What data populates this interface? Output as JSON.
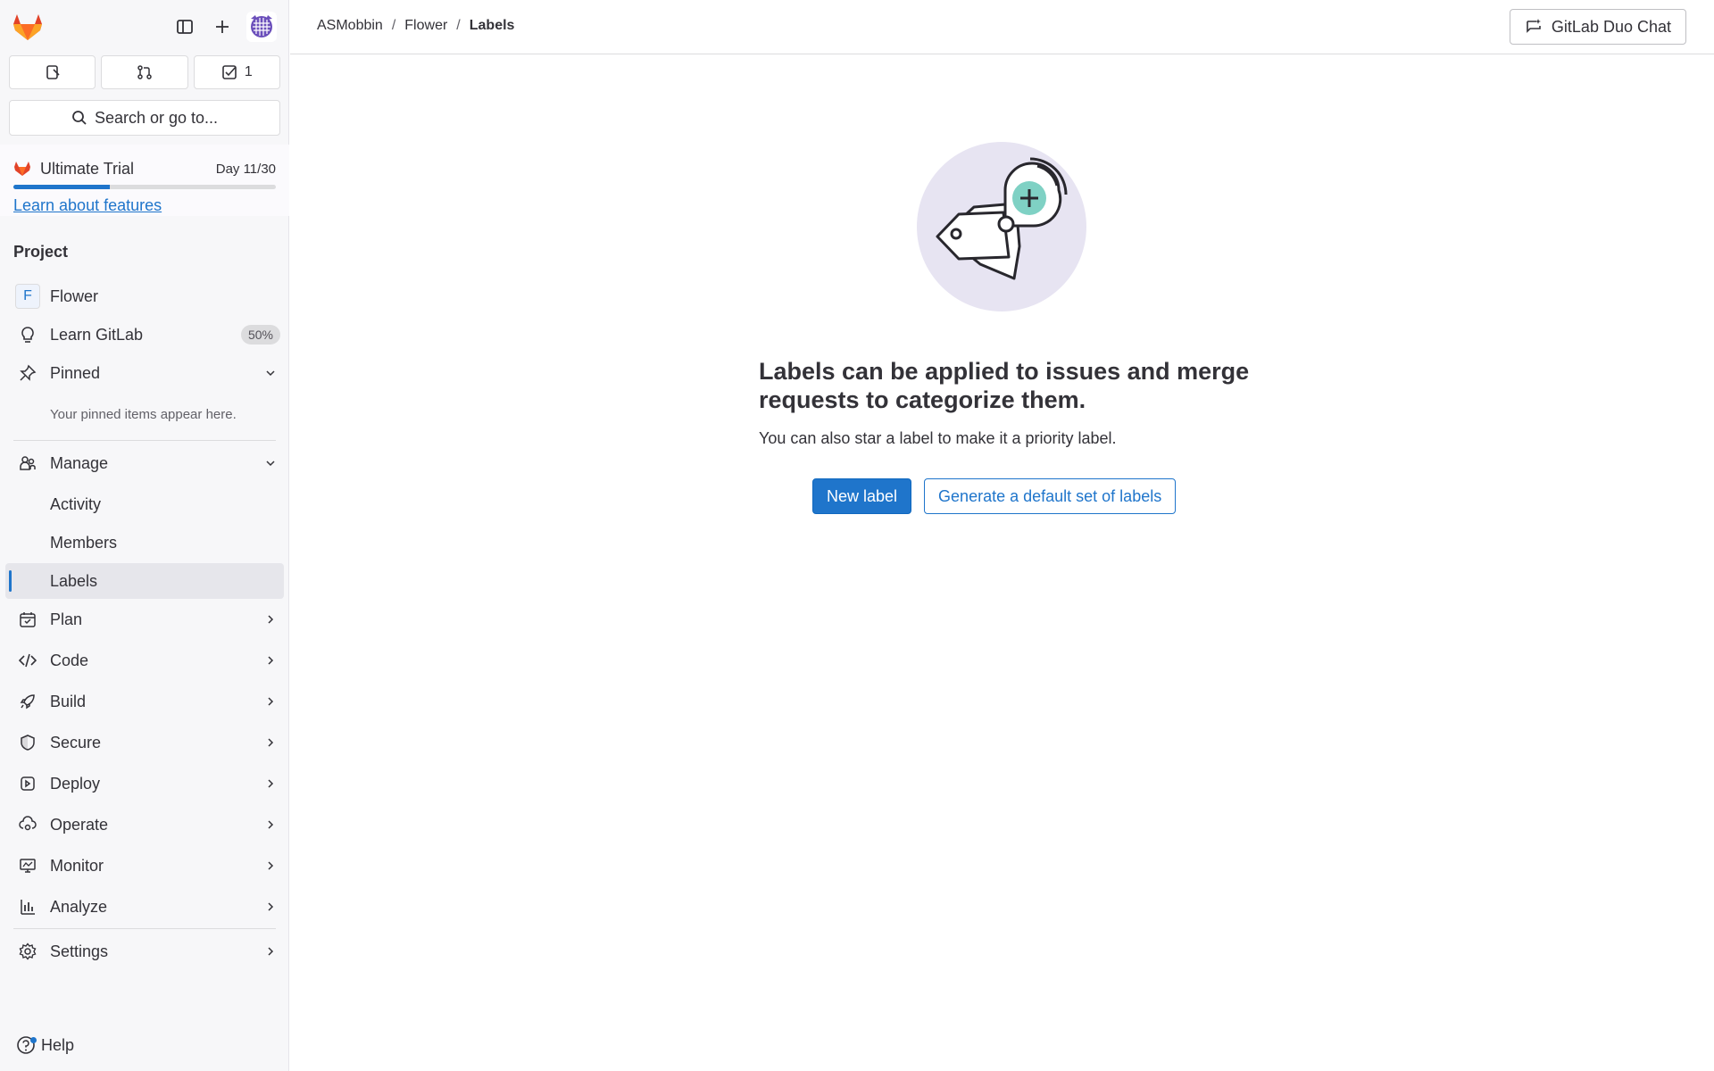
{
  "sidebar": {
    "counters": [
      {
        "icon": "issues-icon",
        "count": ""
      },
      {
        "icon": "merge-request-icon",
        "count": ""
      },
      {
        "icon": "todo-icon",
        "count": "1"
      }
    ],
    "search_label": "Search or go to...",
    "trial": {
      "title": "Ultimate Trial",
      "day": "Day 11/30",
      "progress_fraction": 0.367,
      "link": "Learn about features"
    },
    "section_title": "Project",
    "items": {
      "flower": {
        "letter": "F",
        "label": "Flower"
      },
      "learn": {
        "label": "Learn GitLab",
        "badge": "50%"
      },
      "pinned": {
        "label": "Pinned",
        "empty": "Your pinned items appear here."
      },
      "manage": {
        "label": "Manage"
      },
      "activity": {
        "label": "Activity"
      },
      "members": {
        "label": "Members"
      },
      "labels": {
        "label": "Labels"
      },
      "plan": {
        "label": "Plan"
      },
      "code": {
        "label": "Code"
      },
      "build": {
        "label": "Build"
      },
      "secure": {
        "label": "Secure"
      },
      "deploy": {
        "label": "Deploy"
      },
      "operate": {
        "label": "Operate"
      },
      "monitor": {
        "label": "Monitor"
      },
      "analyze": {
        "label": "Analyze"
      },
      "settings": {
        "label": "Settings"
      }
    },
    "help_label": "Help"
  },
  "topbar": {
    "breadcrumbs": [
      "ASMobbin",
      "Flower",
      "Labels"
    ],
    "duo_label": "GitLab Duo Chat"
  },
  "empty_state": {
    "title": "Labels can be applied to issues and merge requests to categorize them.",
    "description": "You can also star a label to make it a priority label.",
    "primary_button": "New label",
    "secondary_button": "Generate a default set of labels"
  },
  "colors": {
    "accent": "#1f75cb",
    "illustration_bg": "#e7e4f2",
    "illustration_plus": "#7fd1c4"
  }
}
